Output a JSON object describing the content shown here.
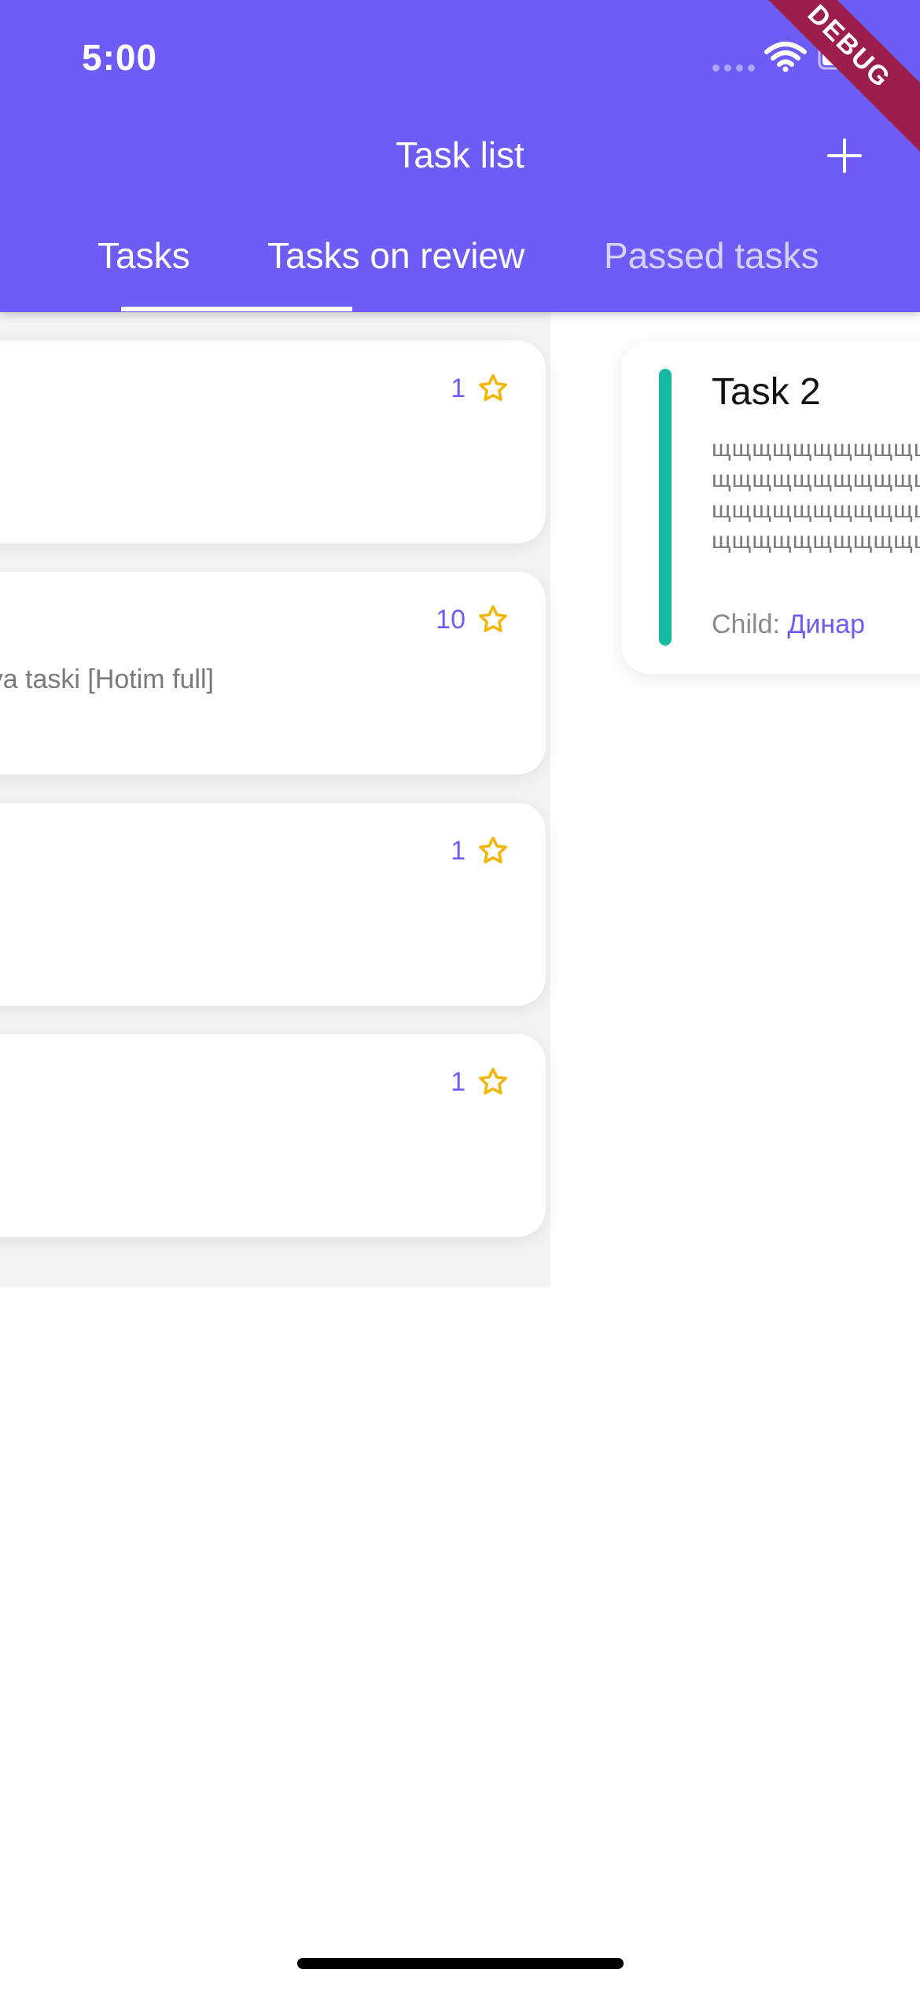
{
  "status_bar": {
    "time": "5:00"
  },
  "debug_banner": {
    "text": "DEBUG"
  },
  "header": {
    "title": "Task list",
    "add_icon": "plus-icon"
  },
  "tabs": [
    {
      "label": "Tasks",
      "selected": true
    },
    {
      "label": "Tasks on review",
      "selected": false
    },
    {
      "label": "Passed tasks",
      "selected": false
    }
  ],
  "tasks_page": {
    "cards": [
      {
        "reward": "1",
        "description": ""
      },
      {
        "reward": "10",
        "description": "va taski [Hotim full]"
      },
      {
        "reward": "1",
        "description": ""
      },
      {
        "reward": "1",
        "description": ""
      }
    ]
  },
  "review_page": {
    "cards": [
      {
        "title": "Task 2",
        "description": "щщщщщщщщщщщщщщщщщщщщщщщщщщщщщщщщщщщщщщщщщщщщщщщщщщщщщщщщщщщщщщщщщщщщщщщщщ",
        "child_label": "Child: ",
        "child_name": "Динар"
      }
    ]
  },
  "colors": {
    "primary": "#6e5cf6",
    "accent_bar": "#16b9a3",
    "star": "#f5b400",
    "debug": "#9c1e4c"
  }
}
